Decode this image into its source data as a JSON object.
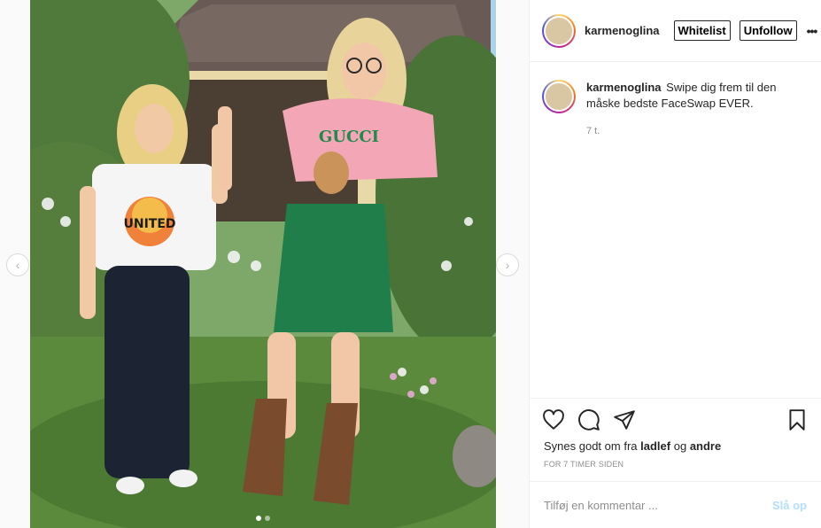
{
  "post": {
    "username": "karmenoglina",
    "whitelist_label": "Whitelist",
    "unfollow_label": "Unfollow",
    "more_label": "•••",
    "caption_username": "karmenoglina",
    "caption_text": "Swipe dig frem til den måske bedste FaceSwap EVER.",
    "caption_time": "7 t.",
    "likes_prefix": "Synes godt om fra",
    "likes_user": "ladlef",
    "likes_joiner": "og",
    "likes_others": "andre",
    "posted_ago": "FOR 7 TIMER SIDEN",
    "comment_placeholder": "Tilføj en kommentar ...",
    "post_label": "Slå op"
  },
  "photo": {
    "shirt_left_text": "UNITED",
    "shirt_right_text": "GUCCI",
    "carousel_count": 2,
    "carousel_active": 1
  },
  "icons": {
    "prev": "chevron-left-icon",
    "next": "chevron-right-icon",
    "like": "heart-icon",
    "comment": "comment-bubble-icon",
    "share": "paper-plane-icon",
    "save": "bookmark-icon"
  },
  "colors": {
    "post_button": "#b2dffc",
    "muted_text": "#8e8e8e",
    "border": "#efefef"
  }
}
